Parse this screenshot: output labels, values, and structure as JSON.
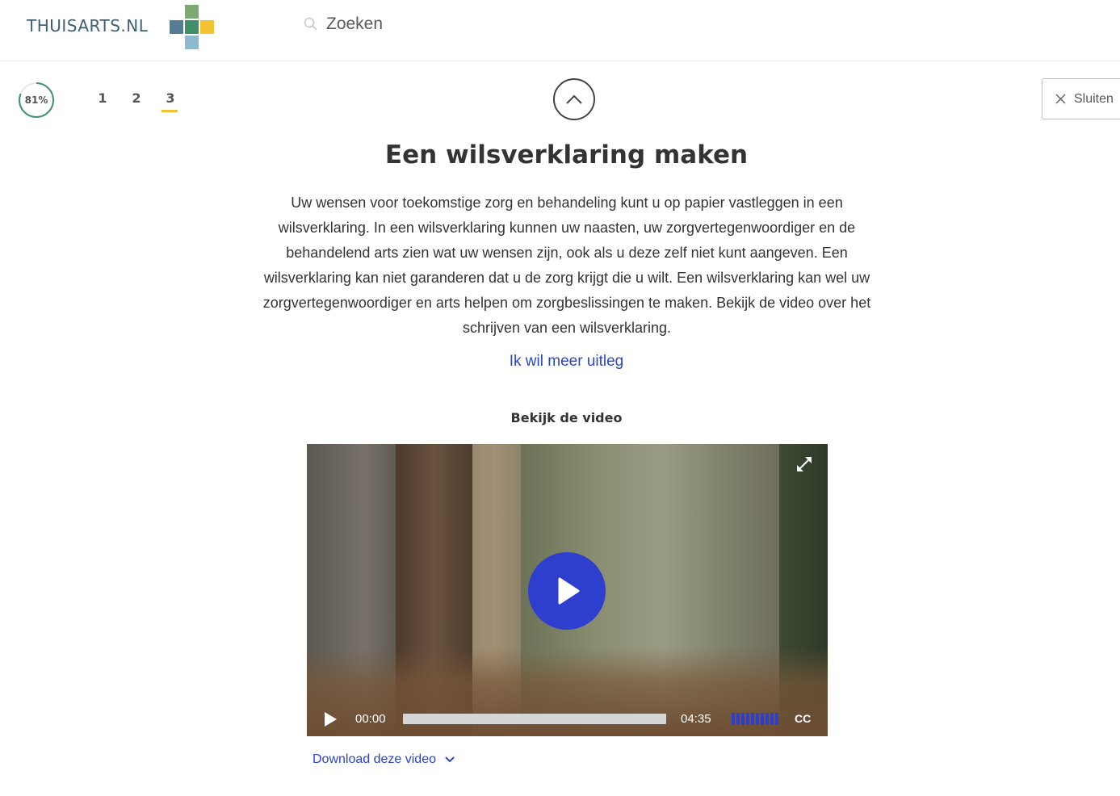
{
  "header": {
    "logo_text": "THUISARTS.NL",
    "search_placeholder": "Zoeken",
    "icons": {
      "search": "search-icon"
    }
  },
  "progress": {
    "percent_label": "81%",
    "value": 0.81,
    "steps": [
      "1",
      "2",
      "3"
    ],
    "active_step": "3"
  },
  "nav": {
    "up_icon": "chevron-up-icon",
    "close_label": "Sluiten",
    "close_icon": "close-icon"
  },
  "content": {
    "title": "Een wilsverklaring maken",
    "body": "Uw wensen voor toekomstige zorg en behandeling kunt u op papier vastleggen in een wilsverklaring. In een wilsverklaring kunnen uw naasten, uw zorgvertegenwoordiger en de behandelend arts zien wat uw wensen zijn, ook als u deze zelf niet kunt aangeven. Een wilsverklaring kan niet garanderen dat u de zorg krijgt die u wilt. Een wilsverklaring kan wel uw zorgvertegenwoordiger en arts helpen om zorgbeslissingen te maken. Bekijk de video over het schrijven van een wilsverklaring.",
    "more_link": "Ik wil meer uitleg"
  },
  "video": {
    "heading": "Bekijk de video",
    "time_current": "00:00",
    "time_total": "04:35",
    "seek_position": 0,
    "cc_label": "CC",
    "download_label": "Download deze video"
  },
  "colors": {
    "accent_blue": "#2e3fd0",
    "link_blue": "#2a45c8",
    "step_underline": "#f2c230",
    "progress_ring": "#3f8f6a"
  }
}
